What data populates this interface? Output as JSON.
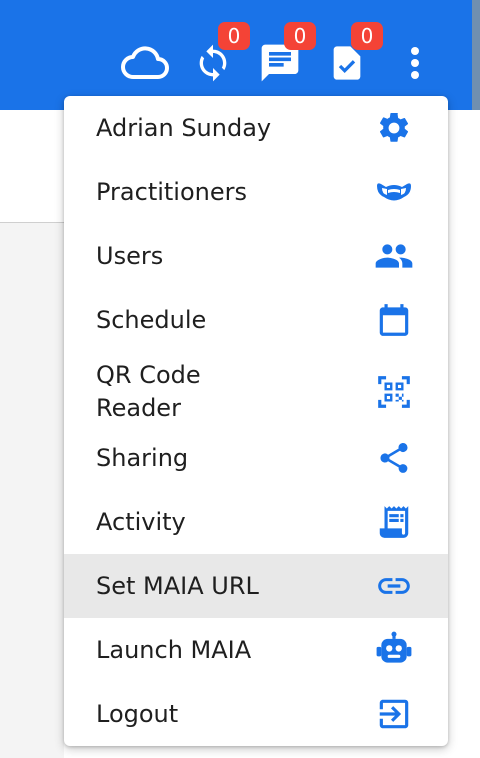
{
  "colors": {
    "appbar": "#1a73e8",
    "badge": "#f44336",
    "icon_accent": "#1a73e8",
    "selected_row": "#e8e8e8"
  },
  "toolbar": {
    "icons": [
      {
        "name": "cloud-icon"
      },
      {
        "name": "sync-icon",
        "badge": "0"
      },
      {
        "name": "chat-icon",
        "badge": "0"
      },
      {
        "name": "task-document-icon",
        "badge": "0"
      },
      {
        "name": "more-vert-icon"
      }
    ]
  },
  "menu": {
    "items": [
      {
        "label": "Adrian Sunday",
        "icon": "gear-icon"
      },
      {
        "label": "Practitioners",
        "icon": "mask-icon"
      },
      {
        "label": "Users",
        "icon": "group-icon"
      },
      {
        "label": "Schedule",
        "icon": "calendar-icon"
      },
      {
        "label": "QR Code Reader",
        "icon": "qr-code-icon"
      },
      {
        "label": "Sharing",
        "icon": "share-icon"
      },
      {
        "label": "Activity",
        "icon": "receipt-icon"
      },
      {
        "label": "Set MAIA URL",
        "icon": "link-icon",
        "selected": true
      },
      {
        "label": "Launch MAIA",
        "icon": "robot-icon"
      },
      {
        "label": "Logout",
        "icon": "logout-icon"
      }
    ]
  }
}
